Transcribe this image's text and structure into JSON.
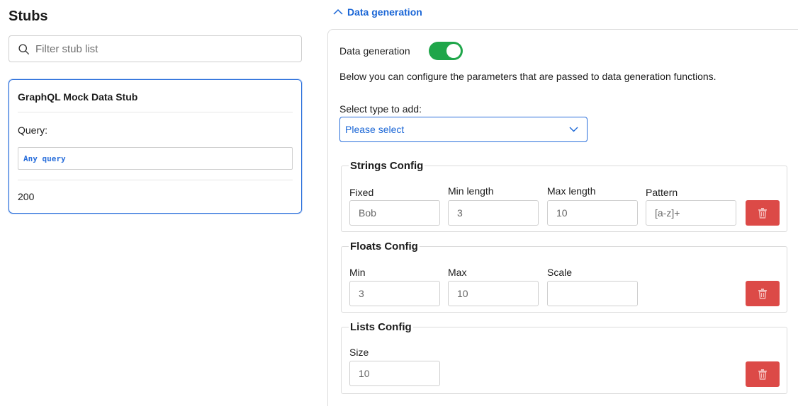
{
  "stubs": {
    "title": "Stubs",
    "filter_placeholder": "Filter stub list",
    "card": {
      "name": "GraphQL Mock Data Stub",
      "query_label": "Query:",
      "query_value": "Any query",
      "status": "200"
    }
  },
  "data_generation": {
    "section_link": "Data generation",
    "toggle_label": "Data generation",
    "toggle_on": true,
    "description": "Below you can configure the parameters that are passed to data generation functions.",
    "select_label": "Select type to add:",
    "select_value": "Please select",
    "configs": {
      "strings": {
        "title": "Strings Config",
        "fixed_label": "Fixed",
        "fixed_value": "Bob",
        "min_length_label": "Min length",
        "min_length_value": "3",
        "max_length_label": "Max length",
        "max_length_value": "10",
        "pattern_label": "Pattern",
        "pattern_value": "[a-z]+"
      },
      "floats": {
        "title": "Floats Config",
        "min_label": "Min",
        "min_value": "3",
        "max_label": "Max",
        "max_value": "10",
        "scale_label": "Scale",
        "scale_value": ""
      },
      "lists": {
        "title": "Lists Config",
        "size_label": "Size",
        "size_value": "10"
      }
    }
  },
  "colors": {
    "accent": "#2a6fdb",
    "toggle": "#1fa64a",
    "danger": "#dc4a47"
  },
  "icons": {
    "search": "search-icon",
    "chevron_up": "chevron-up-icon",
    "chevron_down": "chevron-down-icon",
    "delete": "trash-icon"
  }
}
